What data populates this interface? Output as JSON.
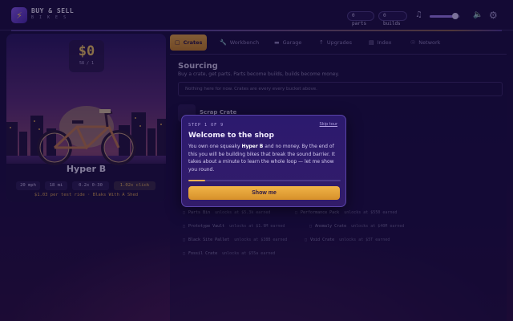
{
  "app": {
    "name": "BUY & SELL",
    "tagline": "B I K E S"
  },
  "header": {
    "parts_label": "0 parts",
    "builds_label": "0 builds",
    "music_icon": "music-note-icon",
    "volume_icon": "speaker-icon",
    "settings_icon": "gear-icon",
    "volume_level": 0.85
  },
  "bike_card": {
    "cash": "$0",
    "cash_sub": "58 / 1",
    "name": "Hyper B",
    "stats": [
      "20 mph",
      "18 mi",
      "0.2x 0-30",
      "1.02x click"
    ],
    "subline": "$1.03 per test ride · Blaks With A Shed"
  },
  "tabs": [
    {
      "label": "Crates",
      "icon": "crate-icon",
      "active": true
    },
    {
      "label": "Workbench",
      "icon": "wrench-icon",
      "active": false
    },
    {
      "label": "Garage",
      "icon": "car-icon",
      "active": false
    },
    {
      "label": "Upgrades",
      "icon": "arrow-up-icon",
      "active": false
    },
    {
      "label": "Index",
      "icon": "book-icon",
      "active": false
    },
    {
      "label": "Network",
      "icon": "network-icon",
      "active": false
    }
  ],
  "sourcing": {
    "title": "Sourcing",
    "subtitle": "Buy a crate, get parts. Parts become builds, builds become money.",
    "hint": "Nothing here for now. Crates are every every bucket above.",
    "scrap_crate": "Scrap Crate"
  },
  "crates": [
    {
      "name": "Parts Bin",
      "unlock": "unlocks at $5.3k earned"
    },
    {
      "name": "Performance Pack",
      "unlock": "unlocks at $550 earned"
    },
    {
      "name": "Prototype Vault",
      "unlock": "unlocks at $1.9M earned"
    },
    {
      "name": "Anomaly Crate",
      "unlock": "unlocks at $40M earned"
    },
    {
      "name": "Black Site Pallet",
      "unlock": "unlocks at $38B earned"
    },
    {
      "name": "Void Crate",
      "unlock": "unlocks at $5T earned"
    },
    {
      "name": "Fossil Crate",
      "unlock": "unlocks at $55a earned"
    }
  ],
  "tutorial": {
    "step": "STEP 1 OF 9",
    "skip": "Skip tour",
    "title": "Welcome to the shop",
    "body_pre": "You own one squeaky ",
    "body_bold": "Hyper B",
    "body_post": " and no money. By the end of this you will be building bikes that break the sound barrier. It takes about a minute to learn the whole loop — let me show you round.",
    "progress": 0.11,
    "button": "Show me"
  },
  "colors": {
    "accent": "#e8a84a",
    "background": "#1a0f45",
    "panel": "#2c1a6e"
  }
}
